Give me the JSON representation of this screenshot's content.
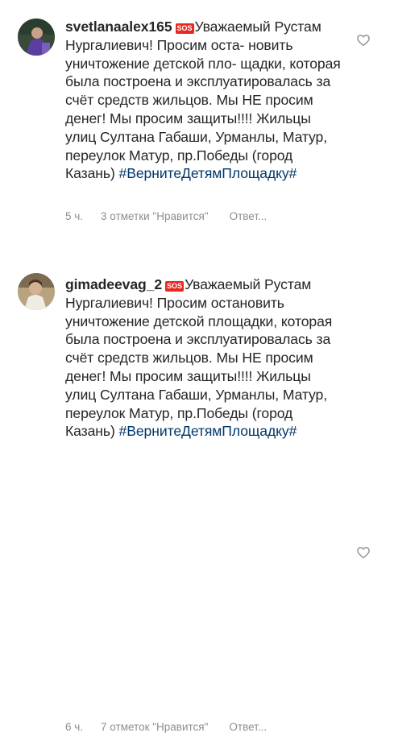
{
  "comments": [
    {
      "username": "svetlanaalex165",
      "sos_badge": "SOS",
      "text": "Уважаемый Рустам Нургалиевич! Просим оста- новить уничтожение детской пло- щадки, которая была построена и эксплуатировалась за счёт средств жильцов. Мы НЕ просим денег!  Мы просим защиты!!!! Жильцы улиц Султана Габаши, Урманлы, Матур, переулок Матур, пр.Победы (город Казань) ",
      "hashtag": "#ВернитеДетямПлощадку#",
      "time": "5 ч.",
      "likes": "3 отметки \"Нравится\"",
      "reply": "Ответ...",
      "avatar_icon": "user-avatar-icon",
      "like_icon": "heart-outline-icon"
    },
    {
      "username": "gimadeevag_2",
      "sos_badge": "SOS",
      "text": "Уважаемый Рустам Нургалиевич! Просим остановить уничтожение детской площадки, которая была построена и эксплуатировалась за счёт средств жильцов. Мы НЕ просим денег!  Мы просим защиты!!!! Жильцы улиц Султана Габаши, Урманлы, Матур, переулок Матур, пр.Победы (город Казань) ",
      "hashtag": "#ВернитеДетямПлощадку#",
      "time": "6 ч.",
      "likes": "7 отметок \"Нравится\"",
      "reply": "Ответ...",
      "avatar_icon": "user-avatar-icon",
      "like_icon": "heart-outline-icon"
    }
  ],
  "colors": {
    "text": "#262626",
    "meta": "#8e8e8e",
    "hashtag": "#00376b",
    "sos_badge": "#e52a24"
  }
}
